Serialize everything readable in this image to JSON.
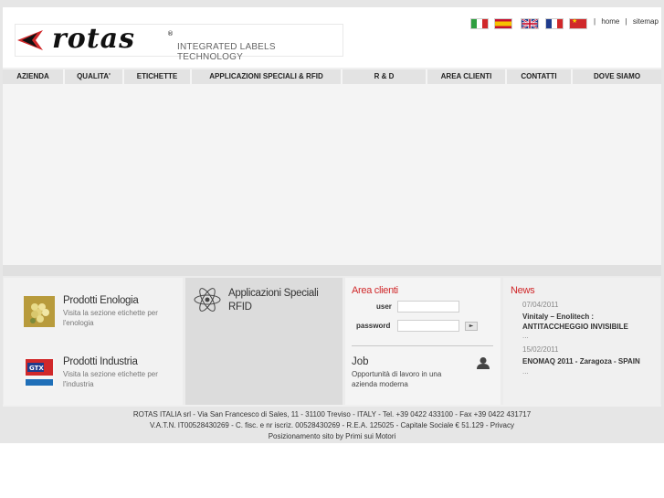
{
  "brand": {
    "name": "rotas",
    "registered": "®",
    "tagline": "INTEGRATED LABELS TECHNOLOGY",
    "accent": "#d0282a"
  },
  "toplinks": {
    "home": "home",
    "separator": "|",
    "sitemap": "sitemap"
  },
  "flags": [
    {
      "name": "italian-flag-icon"
    },
    {
      "name": "spanish-flag-icon"
    },
    {
      "name": "uk-flag-icon"
    },
    {
      "name": "french-flag-icon"
    },
    {
      "name": "chinese-flag-icon"
    }
  ],
  "nav": [
    {
      "label": "AZIENDA"
    },
    {
      "label": "QUALITA'"
    },
    {
      "label": "ETICHETTE"
    },
    {
      "label": "APPLICAZIONI SPECIALI & RFID"
    },
    {
      "label": "R & D"
    },
    {
      "label": "AREA CLIENTI"
    },
    {
      "label": "CONTATTI"
    },
    {
      "label": "DOVE SIAMO"
    }
  ],
  "products": [
    {
      "title": "Prodotti Enologia",
      "desc": "Visita la sezione etichette per l'enologia"
    },
    {
      "title": "Prodotti Industria",
      "desc": "Visita la sezione etichette per l'industria"
    }
  ],
  "rfid": {
    "title_line1": "Applicazioni Speciali",
    "title_line2": "RFID"
  },
  "login": {
    "title": "Area clienti",
    "user_label": "user",
    "password_label": "password",
    "submit_glyph": "►"
  },
  "job": {
    "title": "Job",
    "desc": "Opportunità di lavoro in una azienda moderna"
  },
  "news": {
    "title": "News",
    "items": [
      {
        "date": "07/04/2011",
        "text": "Vinitaly – Enolitech : ANTITACCHEGGIO INVISIBILE",
        "more": "..."
      },
      {
        "date": "15/02/2011",
        "text": "ENOMAQ 2011 - Zaragoza - SPAIN",
        "more": "..."
      }
    ]
  },
  "footer": {
    "line1": "ROTAS ITALIA srl - Via San Francesco di Sales, 11 - 31100 Treviso - ITALY - Tel. +39 0422 433100 - Fax +39 0422 431717",
    "line2": "V.A.T.N. IT00528430269 - C. fisc. e nr iscriz. 00528430269 - R.E.A. 125025 - Capitale Sociale € 51.129 - Privacy",
    "line3": "Posizionamento sito by Primi sui Motori"
  }
}
